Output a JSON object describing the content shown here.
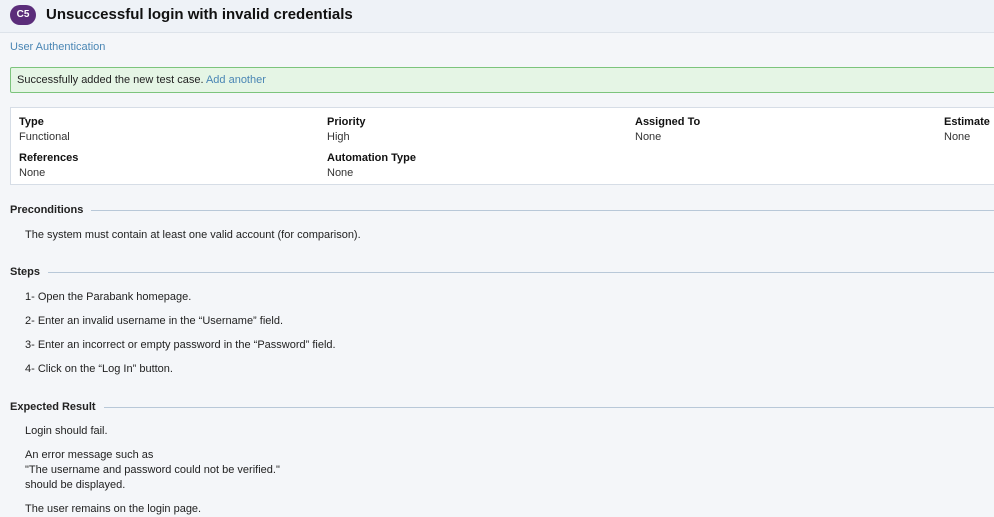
{
  "header": {
    "badge": "C5",
    "title": "Unsuccessful login with invalid credentials"
  },
  "breadcrumb": "User Authentication",
  "notice": {
    "message": "Successfully added the new test case.",
    "link": "Add another"
  },
  "properties": {
    "type": {
      "label": "Type",
      "value": "Functional"
    },
    "priority": {
      "label": "Priority",
      "value": "High"
    },
    "assigned_to": {
      "label": "Assigned To",
      "value": "None"
    },
    "estimate": {
      "label": "Estimate",
      "value": "None"
    },
    "references": {
      "label": "References",
      "value": "None"
    },
    "automation_type": {
      "label": "Automation Type",
      "value": "None"
    }
  },
  "preconditions": {
    "heading": "Preconditions",
    "text": "The system must contain at least one valid account (for comparison)."
  },
  "steps": {
    "heading": "Steps",
    "items": [
      "1- Open the Parabank homepage.",
      "2- Enter an invalid username in the “Username” field.",
      "3- Enter an incorrect or empty password in the “Password” field.",
      "4- Click on the “Log In” button."
    ]
  },
  "expected": {
    "heading": "Expected Result",
    "line1": "Login should fail.",
    "line2": "An error message such as",
    "line3": "\"The username and password could not be verified.\"",
    "line4": "should be displayed.",
    "line5": "The user remains on the login page."
  }
}
